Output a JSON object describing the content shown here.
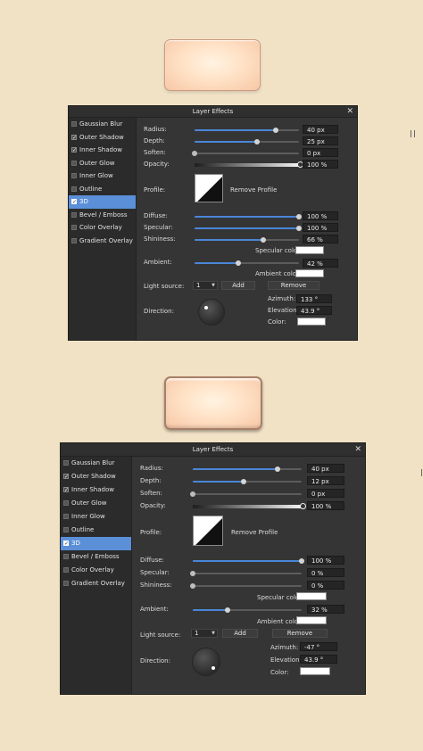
{
  "dialogs": [
    {
      "title": "Layer Effects",
      "close_glyph": "✕",
      "sidebar": [
        {
          "label": "Gaussian Blur",
          "checked": false,
          "active": false
        },
        {
          "label": "Outer Shadow",
          "checked": true,
          "active": false
        },
        {
          "label": "Inner Shadow",
          "checked": true,
          "active": false
        },
        {
          "label": "Outer Glow",
          "checked": false,
          "active": false
        },
        {
          "label": "Inner Glow",
          "checked": false,
          "active": false
        },
        {
          "label": "Outline",
          "checked": false,
          "active": false
        },
        {
          "label": "3D",
          "checked": true,
          "active": true
        },
        {
          "label": "Bevel / Emboss",
          "checked": false,
          "active": false
        },
        {
          "label": "Color Overlay",
          "checked": false,
          "active": false
        },
        {
          "label": "Gradient Overlay",
          "checked": false,
          "active": false
        }
      ],
      "radius": {
        "label": "Radius:",
        "value": "40 px",
        "fraction": 0.78
      },
      "depth": {
        "label": "Depth:",
        "value": "25 px",
        "fraction": 0.6
      },
      "soften": {
        "label": "Soften:",
        "value": "0 px",
        "fraction": 0.0
      },
      "opacity": {
        "label": "Opacity:",
        "value": "100 %",
        "fraction": 1.0
      },
      "profile": {
        "label": "Profile:",
        "remove_label": "Remove Profile"
      },
      "diffuse": {
        "label": "Diffuse:",
        "value": "100 %",
        "fraction": 1.0
      },
      "specular": {
        "label": "Specular:",
        "value": "100 %",
        "fraction": 1.0
      },
      "shininess": {
        "label": "Shininess:",
        "value": "66 %",
        "fraction": 0.66
      },
      "specular_color": {
        "label": "Specular color:",
        "color": "#ffffff"
      },
      "ambient": {
        "label": "Ambient:",
        "value": "42 %",
        "fraction": 0.42
      },
      "ambient_color": {
        "label": "Ambient color:",
        "color": "#ffffff"
      },
      "light_source": {
        "label": "Light source:",
        "selected": "1",
        "add_label": "Add",
        "remove_label": "Remove"
      },
      "direction": {
        "label": "Direction:"
      },
      "azimuth": {
        "label": "Azimuth:",
        "value": "133 °"
      },
      "elevation": {
        "label": "Elevation:",
        "value": "43.9 °"
      },
      "color": {
        "label": "Color:",
        "color": "#ffffff"
      }
    },
    {
      "title": "Layer Effects",
      "close_glyph": "✕",
      "sidebar": [
        {
          "label": "Gaussian Blur",
          "checked": false,
          "active": false
        },
        {
          "label": "Outer Shadow",
          "checked": true,
          "active": false
        },
        {
          "label": "Inner Shadow",
          "checked": true,
          "active": false
        },
        {
          "label": "Outer Glow",
          "checked": false,
          "active": false
        },
        {
          "label": "Inner Glow",
          "checked": false,
          "active": false
        },
        {
          "label": "Outline",
          "checked": false,
          "active": false
        },
        {
          "label": "3D",
          "checked": true,
          "active": true
        },
        {
          "label": "Bevel / Emboss",
          "checked": false,
          "active": false
        },
        {
          "label": "Color Overlay",
          "checked": false,
          "active": false
        },
        {
          "label": "Gradient Overlay",
          "checked": false,
          "active": false
        }
      ],
      "radius": {
        "label": "Radius:",
        "value": "40 px",
        "fraction": 0.78
      },
      "depth": {
        "label": "Depth:",
        "value": "12 px",
        "fraction": 0.47
      },
      "soften": {
        "label": "Soften:",
        "value": "0 px",
        "fraction": 0.0
      },
      "opacity": {
        "label": "Opacity:",
        "value": "100 %",
        "fraction": 1.0
      },
      "profile": {
        "label": "Profile:",
        "remove_label": "Remove Profile"
      },
      "diffuse": {
        "label": "Diffuse:",
        "value": "100 %",
        "fraction": 1.0
      },
      "specular": {
        "label": "Specular:",
        "value": "0 %",
        "fraction": 0.0
      },
      "shininess": {
        "label": "Shininess:",
        "value": "0 %",
        "fraction": 0.0
      },
      "specular_color": {
        "label": "Specular color:",
        "color": "#ffffff"
      },
      "ambient": {
        "label": "Ambient:",
        "value": "32 %",
        "fraction": 0.32
      },
      "ambient_color": {
        "label": "Ambient color:",
        "color": "#ffffff"
      },
      "light_source": {
        "label": "Light source:",
        "selected": "1",
        "add_label": "Add",
        "remove_label": "Remove"
      },
      "direction": {
        "label": "Direction:"
      },
      "azimuth": {
        "label": "Azimuth:",
        "value": "-47 °"
      },
      "elevation": {
        "label": "Elevation:",
        "value": "43.9 °"
      },
      "color": {
        "label": "Color:",
        "color": "#ffffff"
      }
    }
  ],
  "colors": {
    "background": "#f1e2c6",
    "panel": "#353535",
    "accent": "#4a86d8",
    "selected_item": "#5b8fd8"
  }
}
